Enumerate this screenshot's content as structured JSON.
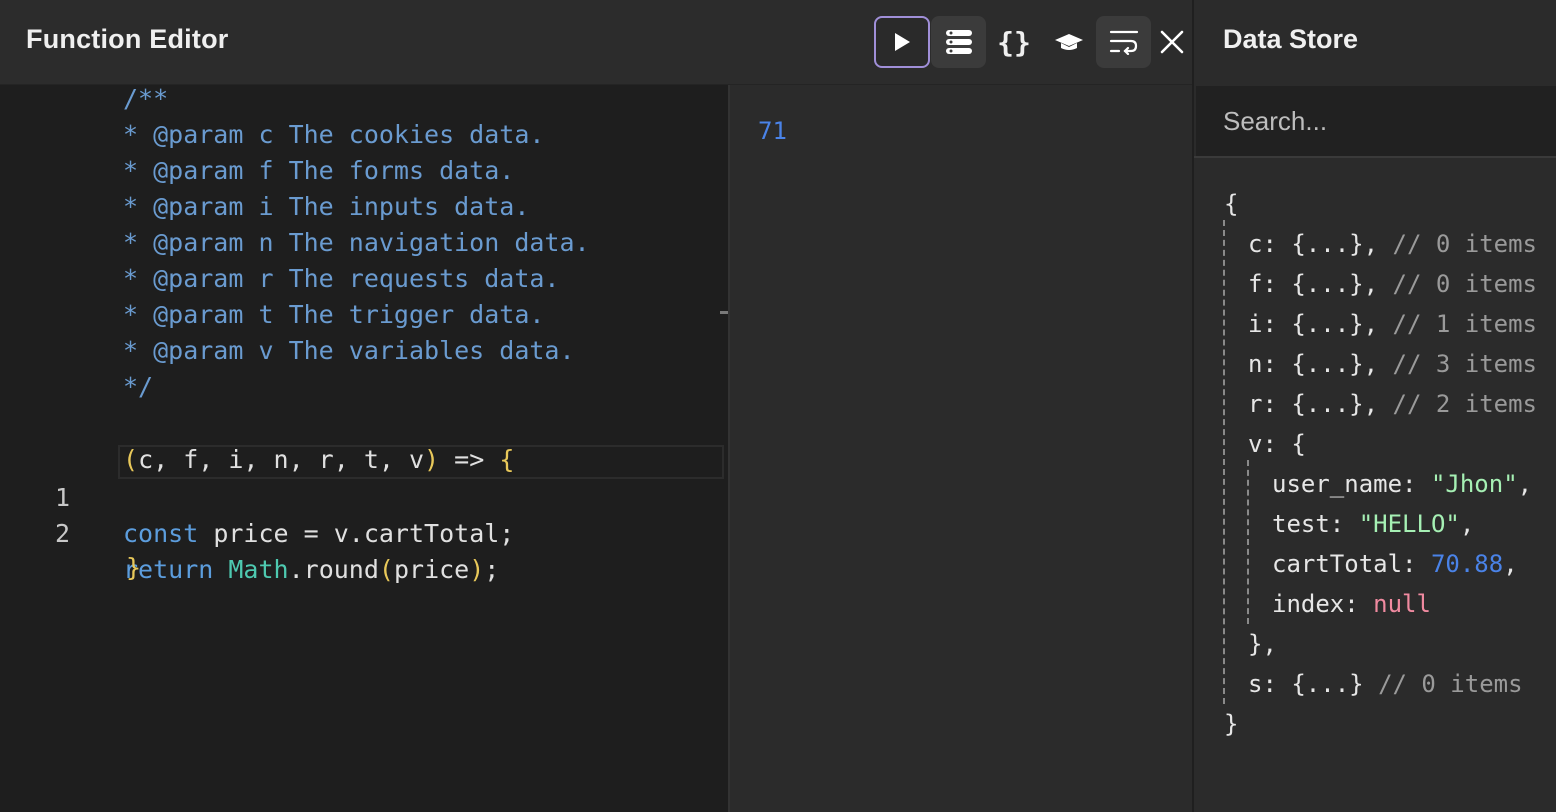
{
  "header": {
    "title": "Function Editor"
  },
  "toolbar": {
    "run": "run",
    "store": "data-store",
    "braces": "{}",
    "hat": "hat",
    "wrap": "wrap",
    "close": "close"
  },
  "editor": {
    "doc_lines": [
      "/**",
      "* @param c The cookies data.",
      "* @param f The forms data.",
      "* @param i The inputs data.",
      "* @param n The navigation data.",
      "* @param r The requests data.",
      "* @param t The trigger data.",
      "* @param v The variables data.",
      "*/"
    ],
    "signature": {
      "open": "(",
      "params": "c, f, i, n, r, t, v",
      "close": ")",
      "arrow": " => ",
      "brace": "{"
    },
    "line1": {
      "num": "1",
      "kw": "const",
      "rest": " price = v.cartTotal;"
    },
    "line2": {
      "num": "2",
      "kw": "return",
      "type": "Math",
      "call": ".round",
      "open": "(",
      "arg": "price",
      "close": ")",
      "end": ";"
    },
    "closing": "}"
  },
  "result": {
    "value": "71"
  },
  "datastore": {
    "title": "Data Store",
    "search_placeholder": "Search...",
    "open_brace": "{",
    "close_brace": "}",
    "rows": [
      {
        "key": "c: ",
        "value": "{...}, ",
        "comment": "// 0 items"
      },
      {
        "key": "f: ",
        "value": "{...}, ",
        "comment": "// 0 items"
      },
      {
        "key": "i: ",
        "value": "{...}, ",
        "comment": "// 1 items"
      },
      {
        "key": "n: ",
        "value": "{...}, ",
        "comment": "// 3 items"
      },
      {
        "key": "r: ",
        "value": "{...}, ",
        "comment": "// 2 items"
      }
    ],
    "v_key": "v: {",
    "v_fields": {
      "user_name": {
        "key": "user_name: ",
        "value": "\"Jhon\"",
        "sep": ","
      },
      "test": {
        "key": "test: ",
        "value": "\"HELLO\"",
        "sep": ","
      },
      "cartTotal": {
        "key": "cartTotal: ",
        "value": "70.88",
        "sep": ","
      },
      "index": {
        "key": "index: ",
        "value": "null"
      }
    },
    "v_close": "},",
    "s_row": {
      "key": "s: ",
      "value": "{...} ",
      "comment": "// 0 items"
    }
  },
  "colors": {
    "accent": "#a08fd8",
    "number": "#4a83e8",
    "string": "#a6f0b4",
    "null": "#f08aa0"
  }
}
